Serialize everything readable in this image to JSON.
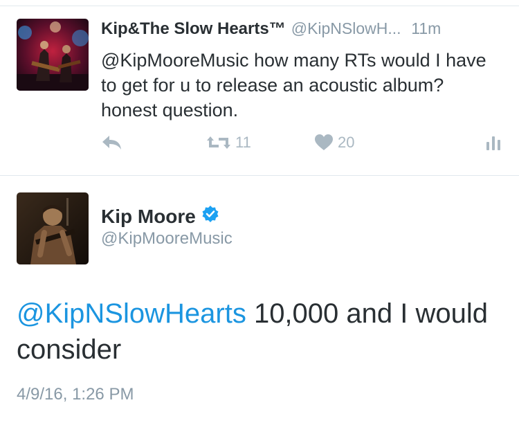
{
  "tweet1": {
    "name": "Kip&The Slow Hearts™",
    "handle": "@KipNSlowH...",
    "time": "11m",
    "text": "@KipMooreMusic how many RTs would I have to get for u to release an acoustic album? honest question.",
    "actions": {
      "reply_icon": "reply-icon",
      "retweet_icon": "retweet-icon",
      "retweet_count": "11",
      "like_icon": "heart-icon",
      "like_count": "20",
      "analytics_icon": "analytics-icon"
    }
  },
  "tweet2": {
    "name": "Kip Moore",
    "verified_icon": "verified-badge-icon",
    "handle": "@KipMooreMusic",
    "mention": "@KipNSlowHearts",
    "text": " 10,000 and I would consider",
    "date": "4/9/16, 1:26 PM"
  },
  "colors": {
    "text": "#292f33",
    "secondary": "#8899a6",
    "action": "#aab8c2",
    "link": "#1b95e0",
    "verified": "#1da1f2",
    "divider": "#e1e8ed"
  }
}
